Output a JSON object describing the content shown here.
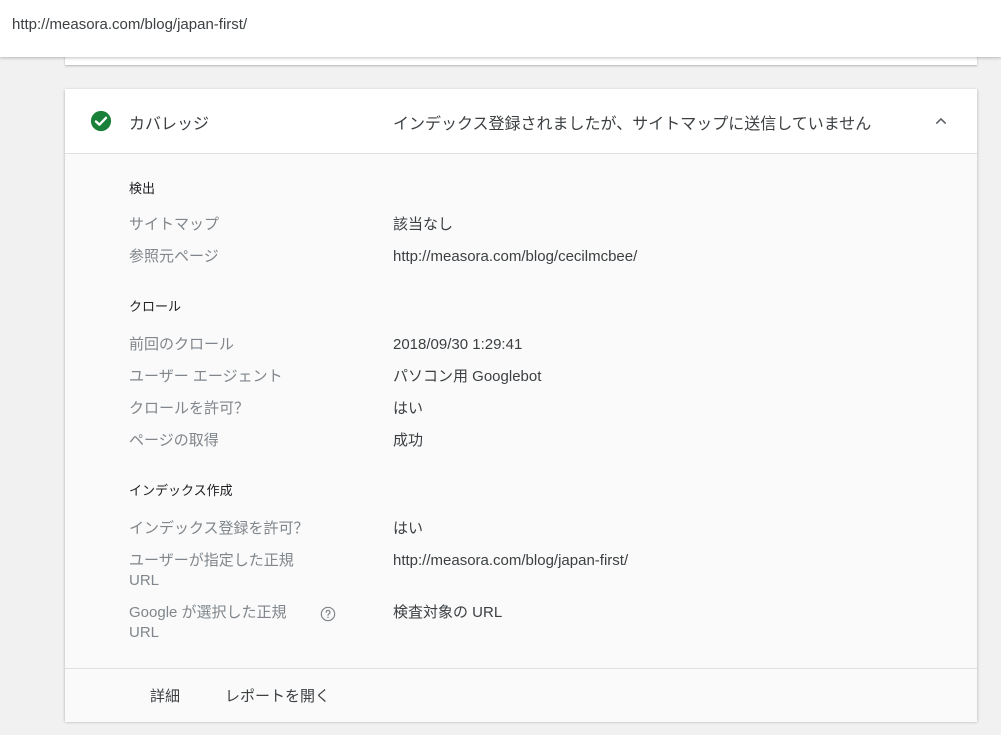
{
  "url_bar": {
    "url": "http://measora.com/blog/japan-first/"
  },
  "coverage": {
    "label": "カバレッジ",
    "status": "インデックス登録されましたが、サイトマップに送信していません",
    "status_color": "#188038"
  },
  "sections": {
    "discovery": {
      "title": "検出",
      "rows": [
        {
          "label": "サイトマップ",
          "value": "該当なし"
        },
        {
          "label": "参照元ページ",
          "value": "http://measora.com/blog/cecilmcbee/"
        }
      ]
    },
    "crawl": {
      "title": "クロール",
      "rows": [
        {
          "label": "前回のクロール",
          "value": "2018/09/30 1:29:41"
        },
        {
          "label": "ユーザー エージェント",
          "value": "パソコン用 Googlebot"
        },
        {
          "label": "クロールを許可？",
          "value": "はい"
        },
        {
          "label": "ページの取得",
          "value": "成功"
        }
      ]
    },
    "indexing": {
      "title": "インデックス作成",
      "rows": [
        {
          "label": "インデックス登録を許可？",
          "value": "はい"
        },
        {
          "label": "ユーザーが指定した正規 URL",
          "value": "http://measora.com/blog/japan-first/"
        },
        {
          "label": "Google が選択した正規 URL",
          "value": "検査対象の URL"
        }
      ]
    }
  },
  "footer": {
    "details_label": "詳細",
    "open_report_label": "レポートを開く"
  }
}
